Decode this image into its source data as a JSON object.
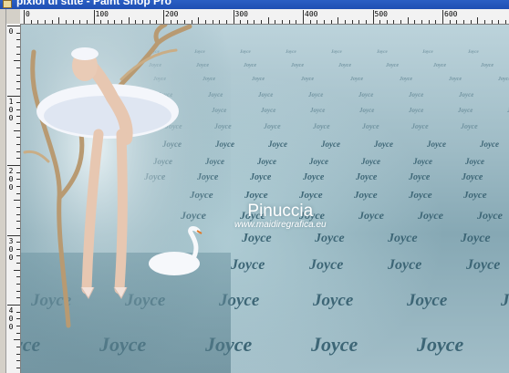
{
  "window": {
    "title": "pixiol di stite - Paint Shop Pro"
  },
  "ruler": {
    "top_labels": [
      "0",
      "100",
      "200",
      "300",
      "400",
      "500",
      "600"
    ],
    "left_labels": [
      "0",
      "100",
      "200",
      "300",
      "400"
    ]
  },
  "canvas": {
    "watermark_word": "Joyce",
    "logo_name": "Pinuccia",
    "logo_url": "www.maidiregrafica.eu",
    "colors": {
      "background": "#9fbcc6",
      "watermark": "#3d6676"
    }
  }
}
